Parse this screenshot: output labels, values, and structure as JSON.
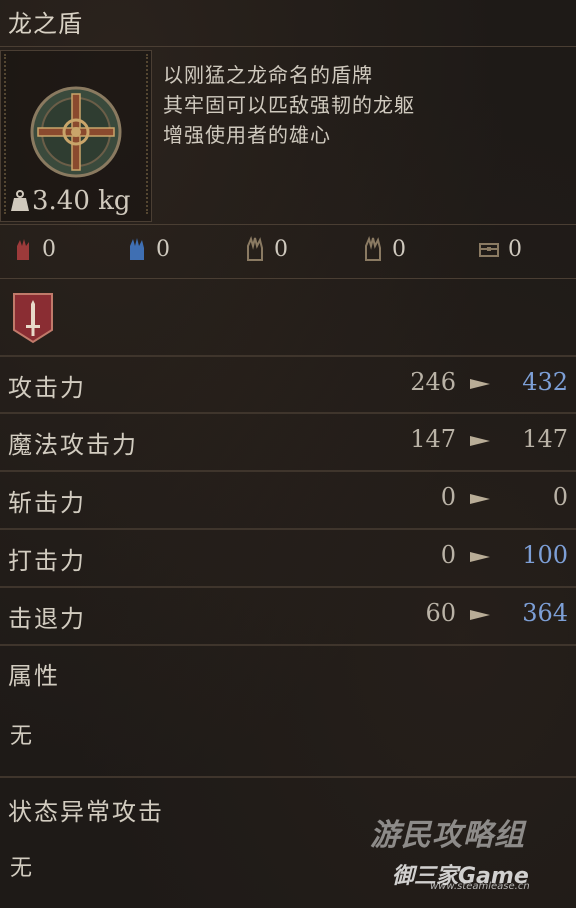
{
  "item": {
    "name": "龙之盾",
    "weight": "3.40 kg",
    "description": [
      "以刚猛之龙命名的盾牌",
      "其牢固可以匹敌强韧的龙躯",
      "增强使用者的雄心"
    ]
  },
  "resistances": [
    {
      "icon": "physical-hand-icon",
      "value": "0",
      "color": "#9c3a3a"
    },
    {
      "icon": "magic-hand-icon",
      "value": "0",
      "color": "#3f6fb3"
    },
    {
      "icon": "fire-hand-icon",
      "value": "0",
      "color": "#8a7a62"
    },
    {
      "icon": "lightning-hand-icon",
      "value": "0",
      "color": "#8a7a62"
    },
    {
      "icon": "chest-icon",
      "value": "0",
      "color": "#8a7a62"
    }
  ],
  "badge_icon": "sword-badge-icon",
  "stats": [
    {
      "name": "攻击力",
      "base": "246",
      "upgraded": "432",
      "improved": true
    },
    {
      "name": "魔法攻击力",
      "base": "147",
      "upgraded": "147",
      "improved": false
    },
    {
      "name": "斩击力",
      "base": "0",
      "upgraded": "0",
      "improved": false
    },
    {
      "name": "打击力",
      "base": "0",
      "upgraded": "100",
      "improved": true
    },
    {
      "name": "击退力",
      "base": "60",
      "upgraded": "364",
      "improved": true
    }
  ],
  "attribute": {
    "title": "属性",
    "value": "无"
  },
  "status_attack": {
    "title": "状态异常攻击",
    "value": "无"
  },
  "watermark": {
    "line1": "游民攻略组",
    "line2": "御三家Game",
    "line3": "www.steamlease.cn"
  },
  "colors": {
    "improved": "#7d9fd6",
    "normal": "#b9b2a6",
    "separator": "#3f352c"
  }
}
